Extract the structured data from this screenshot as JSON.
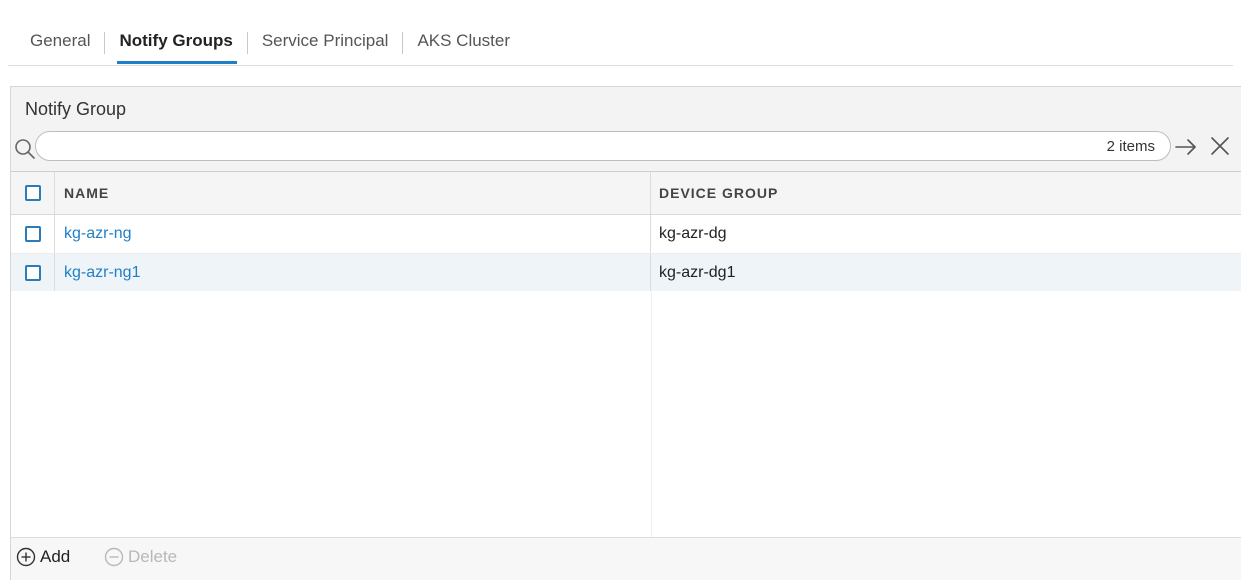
{
  "tabs": [
    {
      "label": "General",
      "active": false
    },
    {
      "label": "Notify Groups",
      "active": true
    },
    {
      "label": "Service Principal",
      "active": false
    },
    {
      "label": "AKS Cluster",
      "active": false
    }
  ],
  "panel": {
    "title": "Notify Group",
    "search": {
      "value": "",
      "placeholder": "",
      "count": "2 items"
    },
    "columns": {
      "name": "NAME",
      "device_group": "DEVICE GROUP"
    },
    "rows": [
      {
        "name": "kg-azr-ng",
        "device_group": "kg-azr-dg",
        "checked": false
      },
      {
        "name": "kg-azr-ng1",
        "device_group": "kg-azr-dg1",
        "checked": false
      }
    ],
    "footer": {
      "add_label": "Add",
      "delete_label": "Delete"
    }
  },
  "colors": {
    "accent": "#1f7fc7",
    "row_alt": "#eef4f8",
    "disabled": "#b8b8b8"
  },
  "icons": {
    "search": "search-icon",
    "go": "arrow-right-icon",
    "clear": "close-icon",
    "add": "plus-circle-icon",
    "delete": "minus-circle-icon"
  }
}
